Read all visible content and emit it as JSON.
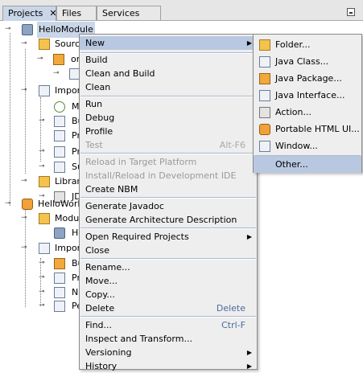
{
  "tabs": [
    {
      "label": "Projects",
      "active": true
    },
    {
      "label": "Files",
      "active": false
    },
    {
      "label": "Services",
      "active": false
    }
  ],
  "tree": [
    {
      "label": "HelloModule",
      "icon": "module-icon"
    },
    {
      "label": "Source",
      "icon": "folder-icon"
    },
    {
      "label": "or",
      "icon": "package-icon"
    },
    {
      "label": "",
      "icon": "file-icon"
    },
    {
      "label": "Import",
      "icon": "file-icon"
    },
    {
      "label": "Mo",
      "icon": "green-circle-icon"
    },
    {
      "label": "Bu",
      "icon": "file-icon"
    },
    {
      "label": "Pr",
      "icon": "file-icon"
    },
    {
      "label": "Pr",
      "icon": "file-icon"
    },
    {
      "label": "Su",
      "icon": "file-icon"
    },
    {
      "label": "Librari",
      "icon": "folder-icon"
    },
    {
      "label": "JD",
      "icon": "library-icon"
    },
    {
      "label": "HelloWorld",
      "icon": "suite-icon"
    },
    {
      "label": "Module",
      "icon": "folder-icon"
    },
    {
      "label": "He",
      "icon": "module-icon"
    },
    {
      "label": "Import",
      "icon": "file-icon"
    },
    {
      "label": "Bu",
      "icon": "package-icon"
    },
    {
      "label": "Pr",
      "icon": "file-icon"
    },
    {
      "label": "Ne",
      "icon": "file-icon"
    },
    {
      "label": "Pe",
      "icon": "file-icon"
    }
  ],
  "menu": [
    {
      "label": "New",
      "highlight": true,
      "submenu": true
    },
    {
      "label": "Build"
    },
    {
      "label": "Clean and Build"
    },
    {
      "label": "Clean"
    },
    {
      "label": "Run"
    },
    {
      "label": "Debug"
    },
    {
      "label": "Profile"
    },
    {
      "label": "Test",
      "disabled": true,
      "accel": "Alt-F6"
    },
    {
      "label": "Reload in Target Platform",
      "disabled": true
    },
    {
      "label": "Install/Reload in Development IDE",
      "disabled": true
    },
    {
      "label": "Create NBM"
    },
    {
      "label": "Generate Javadoc"
    },
    {
      "label": "Generate Architecture Description"
    },
    {
      "label": "Open Required Projects",
      "submenu": true
    },
    {
      "label": "Close"
    },
    {
      "label": "Rename..."
    },
    {
      "label": "Move..."
    },
    {
      "label": "Copy..."
    },
    {
      "label": "Delete",
      "accel": "Delete"
    },
    {
      "label": "Find...",
      "accel": "Ctrl-F"
    },
    {
      "label": "Inspect and Transform..."
    },
    {
      "label": "Versioning",
      "submenu": true
    },
    {
      "label": "History",
      "submenu": true
    }
  ],
  "submenu": [
    {
      "label": "Folder...",
      "icon": "folder-icon"
    },
    {
      "label": "Java Class...",
      "icon": "java-class-icon"
    },
    {
      "label": "Java Package...",
      "icon": "package-icon"
    },
    {
      "label": "Java Interface...",
      "icon": "java-interface-icon"
    },
    {
      "label": "Action...",
      "icon": "action-icon"
    },
    {
      "label": "Portable HTML UI...",
      "icon": "html-ui-icon"
    },
    {
      "label": "Window...",
      "icon": "window-icon"
    },
    {
      "label": "Other...",
      "icon": "",
      "highlight": true
    }
  ],
  "colors": {
    "selection": "#c9d6e8",
    "menu_highlight": "#b8c8e0",
    "accelerator": "#4a6aa0"
  }
}
